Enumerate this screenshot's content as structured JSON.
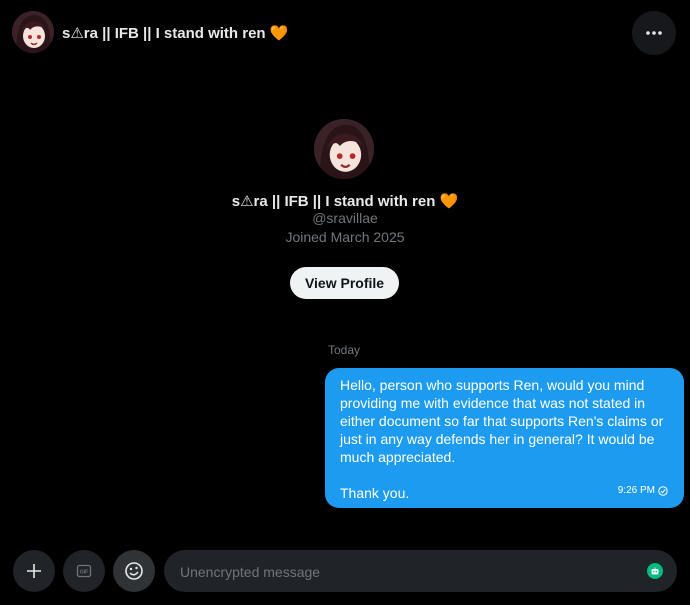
{
  "header": {
    "title": "s⚠ra || IFB || I stand with ren 🧡",
    "more_icon": "more-horizontal-icon"
  },
  "profile": {
    "name": "s⚠ra || IFB || I stand with ren 🧡",
    "handle": "@sravillae",
    "joined": "Joined March 2025",
    "view_profile_label": "View Profile"
  },
  "conversation": {
    "day_label": "Today",
    "messages": [
      {
        "paragraph1": "Hello, person who supports Ren, would you mind providing me with evidence that was not stated in either document so far that supports Ren's claims or just in any way defends her in general? It would be much appreciated.",
        "paragraph2": "Thank you.",
        "time": "9:26 PM",
        "status_icon": "sent-check-icon",
        "bubble_color": "#1d9bf0"
      }
    ]
  },
  "composer": {
    "placeholder": "Unencrypted message",
    "buttons": [
      "plus-icon",
      "gif-icon",
      "emoji-icon"
    ],
    "right_icon": "bot-icon"
  },
  "colors": {
    "background": "#000000",
    "accent": "#1d9bf0",
    "muted_text": "#71767b"
  }
}
